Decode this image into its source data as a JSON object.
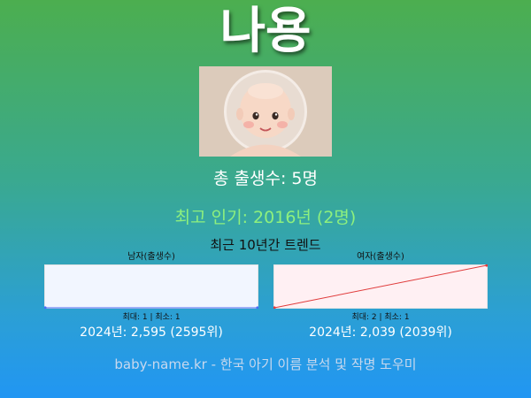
{
  "name": "나용",
  "total_births": "총 출생수: 5명",
  "peak": "최고 인기: 2016년 (2명)",
  "trend_heading": "최근 10년간 트렌드",
  "male": {
    "label": "남자(출생수)",
    "range": "최대: 1 | 최소: 1",
    "latest": "2024년: 2,595 (2595위)"
  },
  "female": {
    "label": "여자(출생수)",
    "range": "최대: 2 | 최소: 1",
    "latest": "2024년: 2,039 (2039위)"
  },
  "footer": "baby-name.kr - 한국 아기 이름 분석 및 작명 도우미",
  "colors": {
    "peak_text": "#8ef07e",
    "male_chart_bg": "#f2f6ff",
    "female_chart_bg": "#fff0f3",
    "female_line": "#e03b3b",
    "male_line": "#4a6cf7"
  },
  "portrait_icon": "baby-face-illustration",
  "chart_data": [
    {
      "type": "line",
      "series": [
        {
          "name": "남자(출생수)",
          "values": [
            1,
            1
          ]
        }
      ],
      "ylim": [
        1,
        1
      ]
    },
    {
      "type": "line",
      "series": [
        {
          "name": "여자(출생수)",
          "values": [
            1,
            2
          ]
        }
      ],
      "ylim": [
        1,
        2
      ]
    }
  ]
}
